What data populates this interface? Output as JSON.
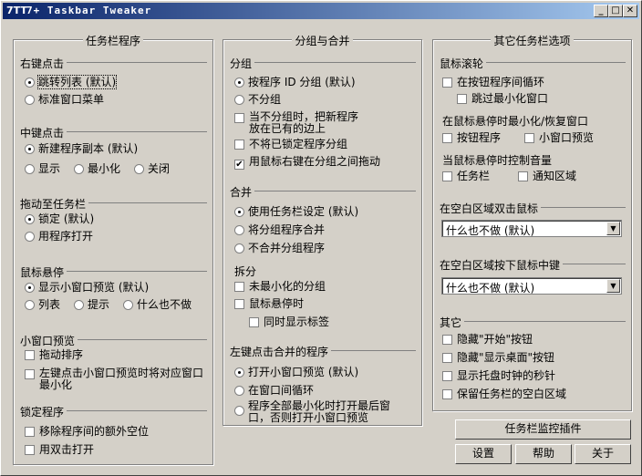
{
  "window": {
    "title": "7+ Taskbar Tweaker",
    "icon_text": "7TT"
  },
  "col1": {
    "title": "任务栏程序",
    "right_click": {
      "title": "右键点击",
      "options": [
        "跳转列表 (默认)",
        "标准窗口菜单"
      ],
      "selected": 0
    },
    "middle_click": {
      "title": "中键点击",
      "options": [
        "新建程序副本 (默认)",
        "显示",
        "最小化",
        "关闭"
      ],
      "selected": 0
    },
    "drag": {
      "title": "拖动至任务栏",
      "options": [
        "锁定 (默认)",
        "用程序打开"
      ],
      "selected": 0
    },
    "hover": {
      "title": "鼠标悬停",
      "options": [
        "显示小窗口预览 (默认)",
        "列表",
        "提示",
        "什么也不做"
      ],
      "selected": 0
    },
    "thumb": {
      "title": "小窗口预览",
      "opt1": "拖动排序",
      "opt2a": "左键点击小窗口预览时将对应窗口",
      "opt2b": "最小化"
    },
    "pinned": {
      "title": "锁定程序",
      "opt1": "移除程序间的额外空位",
      "opt2": "用双击打开"
    }
  },
  "col2": {
    "title": "分组与合并",
    "grouping": {
      "title": "分组",
      "opt1": "按程序 ID 分组 (默认)",
      "opt2": "不分组",
      "opt3a": "当不分组时，把新程序",
      "opt3b": "放在已有的边上",
      "opt4": "不将已锁定程序分组",
      "opt5": "用鼠标右键在分组之间拖动"
    },
    "combine": {
      "title": "合并",
      "opt1": "使用任务栏设定 (默认)",
      "opt2": "将分组程序合并",
      "opt3": "不合并分组程序"
    },
    "decombine": {
      "title": "拆分",
      "opt1": "未最小化的分组",
      "opt2": "鼠标悬停时",
      "opt3": "同时显示标签"
    },
    "left_click": {
      "title": "左键点击合并的程序",
      "opt1": "打开小窗口预览 (默认)",
      "opt2": "在窗口间循环",
      "opt3a": "程序全部最小化时打开最后窗",
      "opt3b": "口，否则打开小窗口预览"
    }
  },
  "col3": {
    "title": "其它任务栏选项",
    "wheel": {
      "title": "鼠标滚轮",
      "opt1": "在按钮程序间循环",
      "opt2": "跳过最小化窗口",
      "label1": "在鼠标悬停时最小化/恢复窗口",
      "opt3": "按钮程序",
      "opt4": "小窗口预览",
      "label2": "当鼠标悬停时控制音量",
      "opt5": "任务栏",
      "opt6": "通知区域"
    },
    "dblclick": {
      "title": "在空白区域双击鼠标",
      "value": "什么也不做 (默认)"
    },
    "midclick": {
      "title": "在空白区域按下鼠标中键",
      "value": "什么也不做 (默认)"
    },
    "other": {
      "title": "其它",
      "opt1": "隐藏\"开始\"按钮",
      "opt2": "隐藏\"显示桌面\"按钮",
      "opt3": "显示托盘时钟的秒针",
      "opt4": "保留任务栏的空白区域"
    }
  },
  "buttons": {
    "inspector": "任务栏监控插件",
    "settings": "设置",
    "help": "帮助",
    "about": "关于"
  }
}
